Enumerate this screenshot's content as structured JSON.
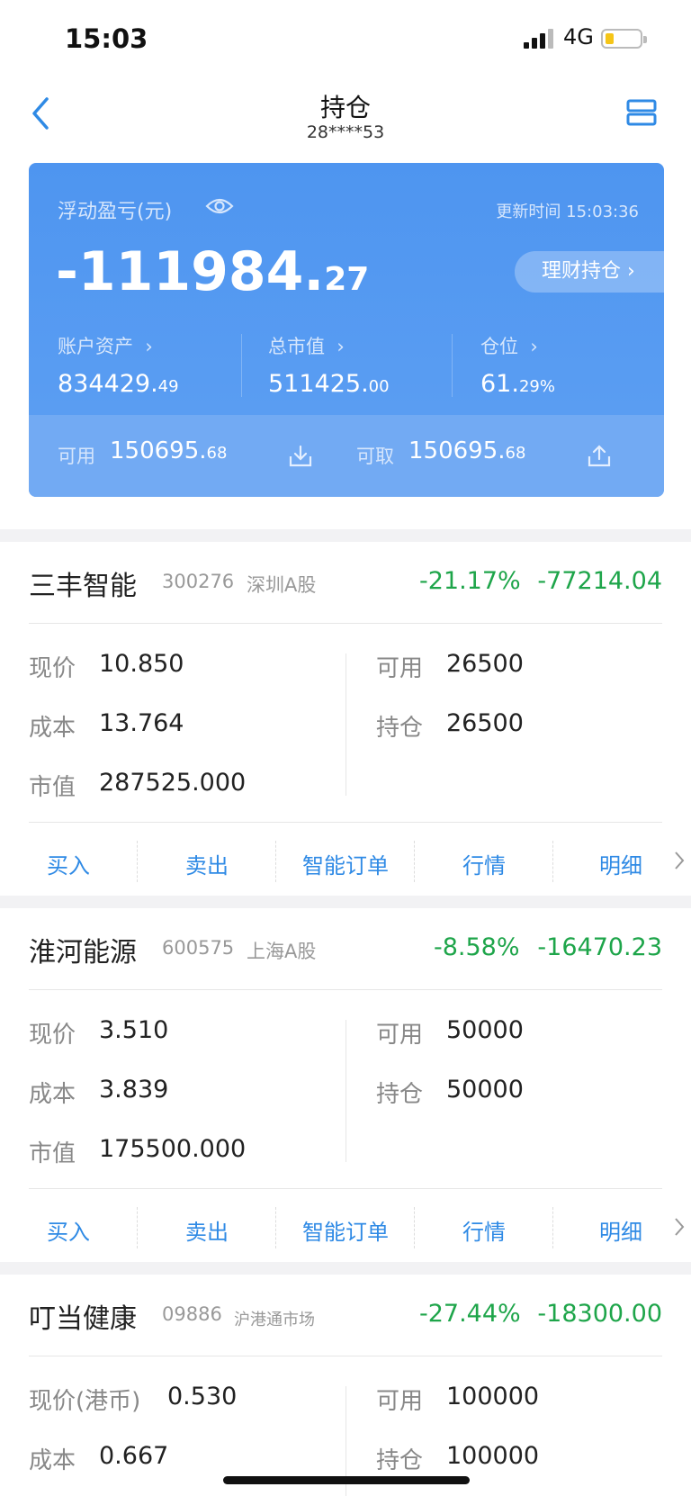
{
  "status": {
    "time": "15:03",
    "network": "4G"
  },
  "nav": {
    "title": "持仓",
    "account": "28****53"
  },
  "summary": {
    "pnl_label": "浮动盈亏(元)",
    "update_time": "更新时间 15:03:36",
    "pnl_main": "-111984.",
    "pnl_decimal": "27",
    "licai_label": "理财持仓",
    "stats": [
      {
        "label": "账户资产",
        "main": "834429.",
        "dec": "49"
      },
      {
        "label": "总市值",
        "main": "511425.",
        "dec": "00"
      },
      {
        "label": "仓位",
        "main": "61.",
        "dec": "29%"
      }
    ],
    "available_label": "可用",
    "available_main": "150695.",
    "available_dec": "68",
    "withdrawable_label": "可取",
    "withdrawable_main": "150695.",
    "withdrawable_dec": "68"
  },
  "holdings": [
    {
      "name": "三丰智能",
      "code": "300276",
      "market": "深圳A股",
      "pct": "-21.17%",
      "pnl": "-77214.04",
      "price_label": "现价",
      "price": "10.850",
      "cost_label": "成本",
      "cost": "13.764",
      "value_label": "市值",
      "value": "287525.000",
      "avail_label": "可用",
      "avail": "26500",
      "pos_label": "持仓",
      "pos": "26500"
    },
    {
      "name": "淮河能源",
      "code": "600575",
      "market": "上海A股",
      "pct": "-8.58%",
      "pnl": "-16470.23",
      "price_label": "现价",
      "price": "3.510",
      "cost_label": "成本",
      "cost": "3.839",
      "value_label": "市值",
      "value": "175500.000",
      "avail_label": "可用",
      "avail": "50000",
      "pos_label": "持仓",
      "pos": "50000"
    },
    {
      "name": "叮当健康",
      "code": "09886",
      "market": "沪港通市场",
      "pct": "-27.44%",
      "pnl": "-18300.00",
      "price_label": "现价(港币)",
      "price": "0.530",
      "cost_label": "成本",
      "cost": "0.667",
      "avail_label": "可用",
      "avail": "100000",
      "pos_label": "持仓",
      "pos": "100000"
    }
  ],
  "actions": [
    "买入",
    "卖出",
    "智能订单",
    "行情",
    "明细"
  ],
  "colors": {
    "accent": "#2f8ae5",
    "loss": "#1ea54a",
    "card": "#4e95f0"
  }
}
